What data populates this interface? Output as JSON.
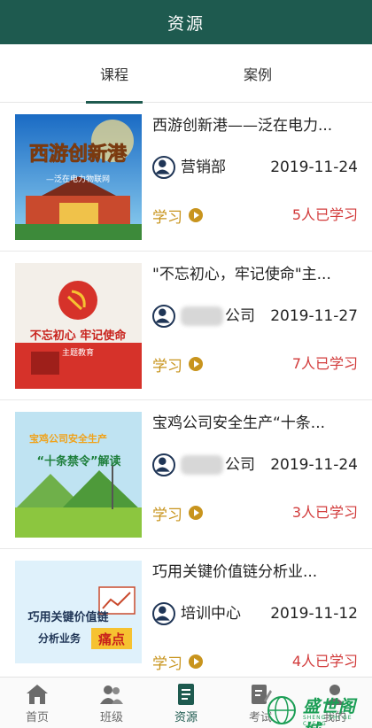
{
  "header": {
    "title": "资源"
  },
  "tabs": [
    {
      "label": "课程",
      "active": true
    },
    {
      "label": "案例",
      "active": false
    }
  ],
  "courses": [
    {
      "title": "西游创新港——泛在电力...",
      "thumb_text": "西游创新港",
      "thumb_sub": "—泛在电力物联网",
      "author": "营销部",
      "date": "2019-11-24",
      "study_label": "学习",
      "count": "5人已学习"
    },
    {
      "title": "\"不忘初心，牢记使命\"主...",
      "thumb_text": "不忘初心 牢记使命",
      "thumb_sub": "主题教育",
      "author": "公司",
      "date": "2019-11-27",
      "study_label": "学习",
      "count": "7人已学习"
    },
    {
      "title": "宝鸡公司安全生产“十条...",
      "thumb_text": "宝鸡公司安全生产",
      "thumb_sub": "“十条禁令”解读",
      "author": "公司",
      "date": "2019-11-24",
      "study_label": "学习",
      "count": "3人已学习"
    },
    {
      "title": "巧用关键价值链分析业...",
      "thumb_text": "巧用关键价值链",
      "thumb_sub": "分析业务",
      "thumb_badge": "痛点",
      "author": "培训中心",
      "date": "2019-11-12",
      "study_label": "学习",
      "count": "4人已学习"
    }
  ],
  "bottom_nav": [
    {
      "label": "首页",
      "icon": "home-icon"
    },
    {
      "label": "班级",
      "icon": "class-icon"
    },
    {
      "label": "资源",
      "icon": "resource-icon",
      "active": true
    },
    {
      "label": "考试",
      "icon": "exam-icon"
    },
    {
      "label": "我的",
      "icon": "profile-icon"
    }
  ],
  "watermark": {
    "text": "盛世阁城",
    "sub": "SHENG SHI GE CHENG"
  },
  "colors": {
    "primary": "#1e5a4f",
    "study": "#c8941d",
    "count": "#d23b3b"
  }
}
